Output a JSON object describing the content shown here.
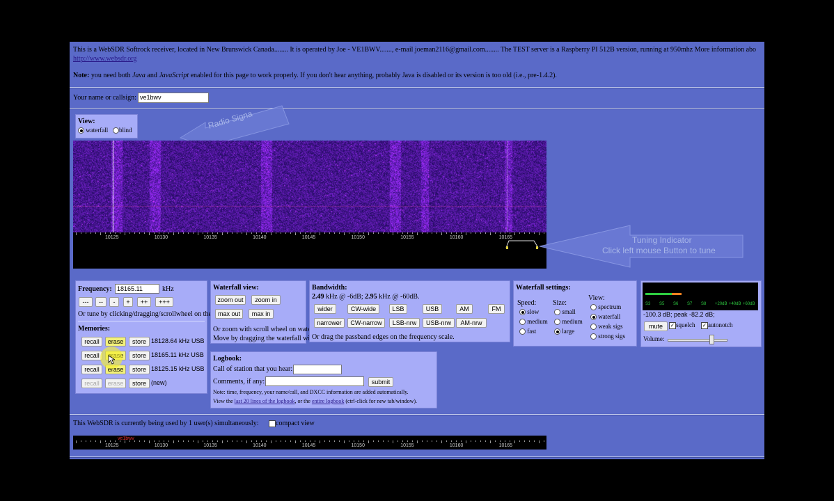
{
  "intro": {
    "line1": "This is a WebSDR Softrock receiver, located in New Brunswick Canada........ It is operated by Joe - VE1BWV......., e-mail joeman2116@gmail.com........ The TEST server is a Raspberry PI 512B version, running at 950mhz More information abo",
    "link": "http://www.websdr.org",
    "note_label": "Note:",
    "note_a": " you need both ",
    "java": "Java",
    "and": " and ",
    "javascript": "JavaScript",
    "note_b": " enabled for this page to work properly. If you don't hear anything, probably Java is disabled or its version is too old (i.e., pre-1.4.2)."
  },
  "callsign": {
    "label": "Your name or callsign:",
    "value": "ve1bwv"
  },
  "view": {
    "title": "View:",
    "waterfall_label": "waterfall",
    "blind_label": "blind",
    "selected": "waterfall"
  },
  "annotations": {
    "radio_signal": "Radio Signa",
    "tuning_title": "Tuning Indicator",
    "tuning_sub": "Click left mouse Button to tune"
  },
  "freq_scale": [
    "10125",
    "10130",
    "10135",
    "10140",
    "10145",
    "10150",
    "10155",
    "10160",
    "10165"
  ],
  "frequency": {
    "label": "Frequency:",
    "value": "18165.11",
    "unit": "kHz",
    "step_buttons": [
      "---",
      "--",
      "-",
      "+",
      "++",
      "+++"
    ],
    "hint": "Or tune by clicking/dragging/scrollwheel on the frequency scale."
  },
  "memories": {
    "title": "Memories:",
    "rows": [
      {
        "recall": "recall",
        "erase": "erase",
        "store": "store",
        "value": "18128.64 kHz USB"
      },
      {
        "recall": "recall",
        "erase": "erase",
        "store": "store",
        "value": "18165.11 kHz USB"
      },
      {
        "recall": "recall",
        "erase": "erase",
        "store": "store",
        "value": "18125.15 kHz USB"
      },
      {
        "recall": "recall",
        "erase": "erase",
        "store": "store",
        "value": "(new)"
      }
    ]
  },
  "waterfall_view": {
    "title": "Waterfall view:",
    "zoom_out": "zoom out",
    "zoom_in": "zoom in",
    "max_out": "max out",
    "max_in": "max in",
    "hint1": "Or zoom with scroll wheel on waterfall.",
    "hint2": "Move by dragging the waterfall with the mouse."
  },
  "bandwidth": {
    "title": "Bandwidth:",
    "bw1": "2.49",
    "bw1_txt": " kHz @ -6dB; ",
    "bw2": "2.95",
    "bw2_txt": " kHz @ -60dB.",
    "row1": [
      "wider",
      "CW-wide",
      "LSB",
      "USB",
      "AM",
      "FM"
    ],
    "row2": [
      "narrower",
      "CW-narrow",
      "LSB-nrw",
      "USB-nrw",
      "AM-nrw"
    ],
    "hint": "Or drag the passband edges on the frequency scale."
  },
  "waterfall_settings": {
    "title": "Waterfall settings:",
    "speed_label": "Speed:",
    "speed_options": [
      "slow",
      "medium",
      "fast"
    ],
    "speed_selected": "slow",
    "size_label": "Size:",
    "size_options": [
      "small",
      "medium",
      "large"
    ],
    "size_selected": "large",
    "view_label": "View:",
    "view_options": [
      "spectrum",
      "waterfall",
      "weak sigs",
      "strong sigs"
    ],
    "view_selected": "waterfall"
  },
  "audio": {
    "smeter_labels": [
      "S3",
      "S5",
      "S6",
      "S7",
      "S8",
      "+20dB",
      "+40dB",
      "+60dB"
    ],
    "readout": "-100.3 dB; peak   -82.2 dB;",
    "mute": "mute",
    "squelch": "squelch",
    "autonotch": "autonotch",
    "volume": "Volume:",
    "volume_level": 0.75
  },
  "logbook": {
    "title": "Logbook:",
    "call_label": "Call of station that you hear:",
    "comments_label": "Comments, if any:",
    "submit": "submit",
    "note": "Note: time, frequency, your name/call, and DXCC information are added automatically.",
    "view_pre": "View the ",
    "link1": "last 20 lines of the logbook",
    "view_mid": ", or the ",
    "link2": "entire logbook",
    "view_post": " (ctrl-click for new tab/window)."
  },
  "footer": {
    "users": "This WebSDR is currently being used by 1 user(s) simultaneously:",
    "compact": "compact view",
    "user_tag": "ve1bwv"
  },
  "colors": {
    "page_bg": "#5a6ac8",
    "panel_bg": "#a7acf8",
    "waterfall_bg": "#1a0d5c",
    "highlight": "#f3f17a"
  }
}
